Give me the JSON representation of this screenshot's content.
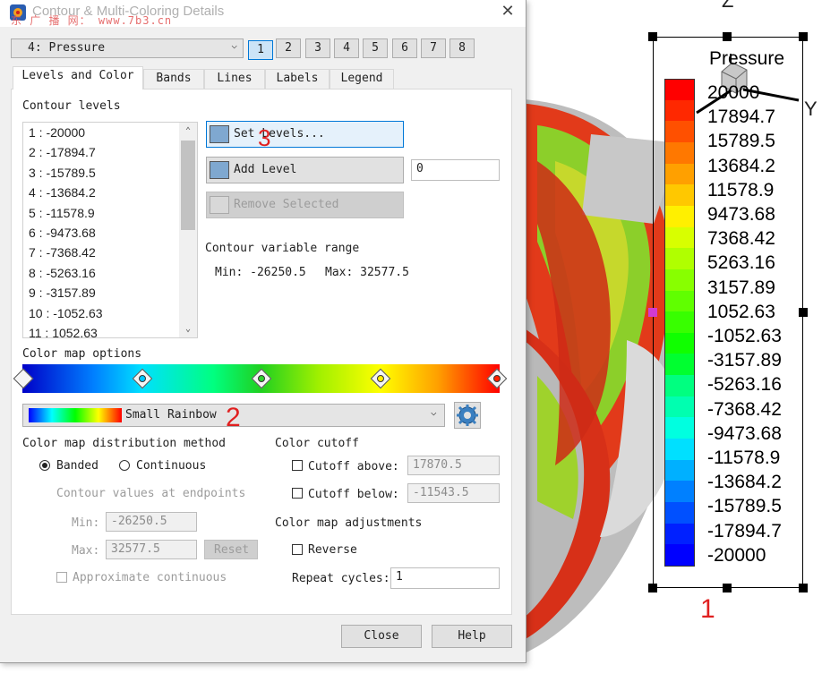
{
  "title": {
    "window": "Contour & Multi-Coloring Details",
    "watermark": "东 广 播 网： www.7b3.cn",
    "close": "✕"
  },
  "variable_select": {
    "value": "4: Pressure"
  },
  "group_buttons": [
    "1",
    "2",
    "3",
    "4",
    "5",
    "6",
    "7",
    "8"
  ],
  "tabs": [
    "Levels and Color",
    "Bands",
    "Lines",
    "Labels",
    "Legend"
  ],
  "levels": {
    "section_label": "Contour levels",
    "items": [
      "1 : -20000",
      "2 : -17894.7",
      "3 : -15789.5",
      "4 : -13684.2",
      "5 : -11578.9",
      "6 : -9473.68",
      "7 : -7368.42",
      "8 : -5263.16",
      "9 : -3157.89",
      "10 : -1052.63",
      "11 : 1052.63"
    ],
    "set_levels": "Set Levels...",
    "add_level": "Add Level",
    "add_level_value": "0",
    "remove_selected": "Remove Selected",
    "range_label": "Contour variable range",
    "min_text": "Min: -26250.5",
    "max_text": "Max: 32577.5"
  },
  "colormap": {
    "section_label": "Color map options",
    "selected": "Small Rainbow",
    "distribution_label": "Color map distribution method",
    "banded": "Banded",
    "continuous": "Continuous",
    "endpoints_label": "Contour values at endpoints",
    "min_label": "Min:",
    "min_value": "-26250.5",
    "max_label": "Max:",
    "max_value": "32577.5",
    "reset": "Reset",
    "approx": "Approximate continuous",
    "cutoff_label": "Color cutoff",
    "cutoff_above": "Cutoff above:",
    "cutoff_above_value": "17870.5",
    "cutoff_below": "Cutoff below:",
    "cutoff_below_value": "-11543.5",
    "adjust_label": "Color map adjustments",
    "reverse": "Reverse",
    "repeat_label": "Repeat cycles:",
    "repeat_value": "1"
  },
  "bottom": {
    "close": "Close",
    "help": "Help"
  },
  "annotations": {
    "one": "1",
    "two": "2",
    "three": "3"
  },
  "legend": {
    "title": "Pressure",
    "labels": [
      "20000",
      "17894.7",
      "15789.5",
      "13684.2",
      "11578.9",
      "9473.68",
      "7368.42",
      "5263.16",
      "3157.89",
      "1052.63",
      "-1052.63",
      "-3157.89",
      "-5263.16",
      "-7368.42",
      "-9473.68",
      "-11578.9",
      "-13684.2",
      "-15789.5",
      "-17894.7",
      "-20000"
    ],
    "colors": [
      "#ff0000",
      "#ff2800",
      "#ff5000",
      "#ff7800",
      "#ffa000",
      "#ffc800",
      "#fff000",
      "#d8ff00",
      "#b0ff00",
      "#88ff00",
      "#60ff00",
      "#38ff00",
      "#10ff00",
      "#00ff30",
      "#00ff80",
      "#00ffb0",
      "#00ffe0",
      "#00e0ff",
      "#00b0ff",
      "#0080ff",
      "#0050ff",
      "#0020ff",
      "#0000ff"
    ],
    "axis_z": "Z",
    "axis_y": "Y"
  }
}
